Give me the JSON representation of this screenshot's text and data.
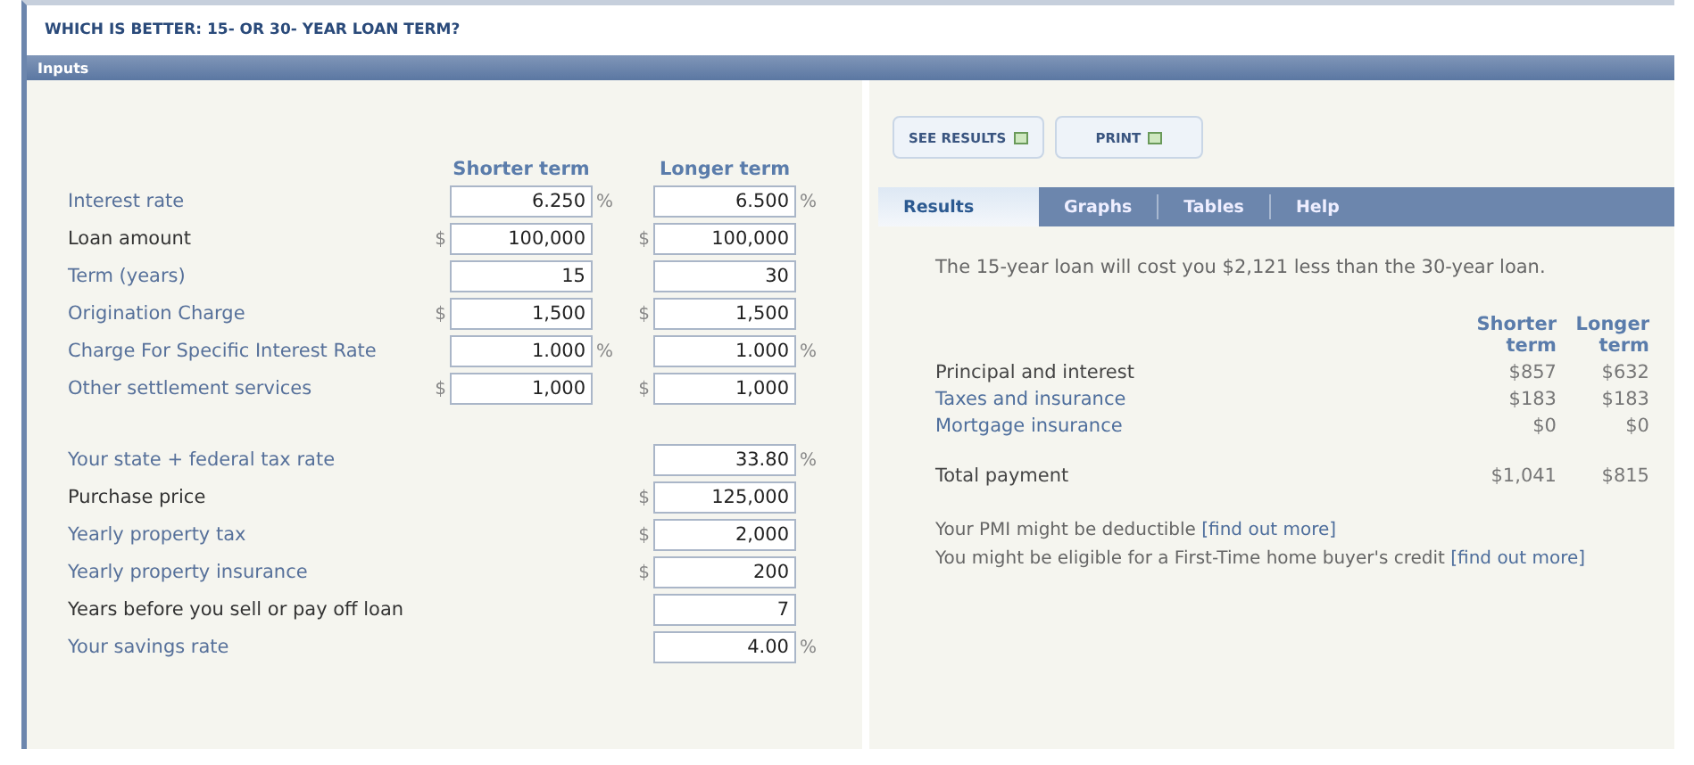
{
  "title": "WHICH IS BETTER: 15- OR 30- YEAR LOAN TERM?",
  "inputs": {
    "header": "Inputs",
    "columns": [
      "Shorter term",
      "Longer term"
    ],
    "rows": [
      {
        "label": "Interest rate",
        "link": true,
        "cells": [
          {
            "value": "6.250",
            "suffix": "%"
          },
          {
            "value": "6.500",
            "suffix": "%"
          }
        ]
      },
      {
        "label": "Loan amount",
        "link": false,
        "cells": [
          {
            "prefix": "$",
            "value": "100,000"
          },
          {
            "prefix": "$",
            "value": "100,000"
          }
        ]
      },
      {
        "label": "Term (years)",
        "link": true,
        "cells": [
          {
            "value": "15"
          },
          {
            "value": "30"
          }
        ]
      },
      {
        "label": "Origination Charge",
        "link": true,
        "cells": [
          {
            "prefix": "$",
            "value": "1,500"
          },
          {
            "prefix": "$",
            "value": "1,500"
          }
        ]
      },
      {
        "label": "Charge For Specific Interest Rate",
        "link": true,
        "cells": [
          {
            "value": "1.000",
            "suffix": "%"
          },
          {
            "value": "1.000",
            "suffix": "%"
          }
        ]
      },
      {
        "label": "Other settlement services",
        "link": true,
        "cells": [
          {
            "prefix": "$",
            "value": "1,000"
          },
          {
            "prefix": "$",
            "value": "1,000"
          }
        ]
      }
    ],
    "shared_rows": [
      {
        "label": "Your state + federal tax rate",
        "link": true,
        "value": "33.80",
        "suffix": "%"
      },
      {
        "label": "Purchase price",
        "link": false,
        "prefix": "$",
        "value": "125,000"
      },
      {
        "label": "Yearly property tax",
        "link": true,
        "prefix": "$",
        "value": "2,000"
      },
      {
        "label": "Yearly property insurance",
        "link": true,
        "prefix": "$",
        "value": "200"
      },
      {
        "label": "Years before you sell or pay off loan",
        "link": false,
        "value": "7"
      },
      {
        "label": "Your savings rate",
        "link": true,
        "value": "4.00",
        "suffix": "%"
      }
    ]
  },
  "buttons": [
    "SEE RESULTS",
    "PRINT"
  ],
  "tabs": [
    {
      "label": "Results",
      "selected": true
    },
    {
      "label": "Graphs",
      "selected": false
    },
    {
      "label": "Tables",
      "selected": false
    },
    {
      "label": "Help",
      "selected": false
    }
  ],
  "results": {
    "summary": "The 15-year loan will cost you $2,121 less than the 30-year loan.",
    "columns": [
      "Shorter term",
      "Longer term"
    ],
    "rows": [
      {
        "label": "Principal and interest",
        "link": false,
        "values": [
          "$857",
          "$632"
        ]
      },
      {
        "label": "Taxes and insurance",
        "link": true,
        "values": [
          "$183",
          "$183"
        ]
      },
      {
        "label": "Mortgage insurance",
        "link": true,
        "values": [
          "$0",
          "$0"
        ]
      }
    ],
    "total": {
      "label": "Total payment",
      "values": [
        "$1,041",
        "$815"
      ]
    },
    "notes": [
      {
        "text": "Your PMI might be deductible",
        "link": "[find out more]"
      },
      {
        "text": "You might be eligible for a First-Time home buyer's credit",
        "link": "[find out more]"
      }
    ]
  }
}
